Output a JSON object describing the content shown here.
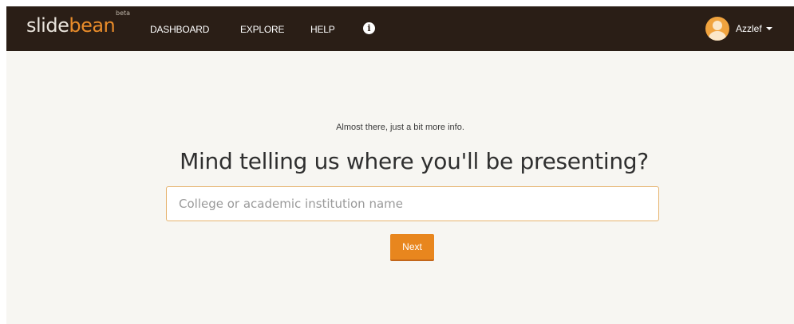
{
  "navbar": {
    "logo": {
      "part1": "slide",
      "part2": "bean",
      "badge": "beta"
    },
    "links": [
      {
        "label": "DASHBOARD"
      },
      {
        "label": "EXPLORE"
      },
      {
        "label": "HELP"
      }
    ],
    "info_icon": {
      "glyph": "i",
      "icon": "info-icon"
    },
    "user": {
      "name": "Azzlef"
    }
  },
  "main": {
    "subtitle": "Almost there, just a bit more info.",
    "headline": "Mind telling us where you'll be presenting?",
    "institution_input": {
      "placeholder": "College or academic institution name",
      "value": ""
    },
    "next_label": "Next"
  },
  "colors": {
    "navbar_bg": "#2a1e16",
    "accent": "#e8861e",
    "page_bg": "#f7f6f2"
  }
}
